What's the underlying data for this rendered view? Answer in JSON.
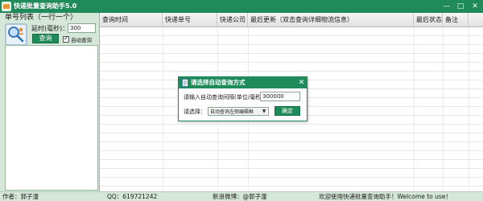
{
  "window": {
    "title": "快递批量查询助手5.0",
    "controls": {
      "minimize": "—",
      "maximize": "□",
      "close": "✕"
    }
  },
  "left_panel": {
    "list_title": "单号列表（一行一个）",
    "delay_label": "延时(毫秒)：",
    "delay_value": "300",
    "query_button": "查询",
    "auto_query_label": "自动查询",
    "auto_query_checked": true,
    "icons": {
      "query": "magnifier-person-icon"
    }
  },
  "table": {
    "headers": [
      "查询时间",
      "快递单号",
      "快递公司",
      "最后更新（双击查询详细物流信息）",
      "最后状态",
      "备注"
    ],
    "rows": []
  },
  "status_bar": {
    "author": "作者：郭子潼",
    "qq": "QQ：619721242",
    "weibo": "新浪微博：@郭子潼",
    "welcome": "欢迎使用快递批量查询助手！Welcome to use！"
  },
  "dialog": {
    "title": "请选择自动查询方式",
    "interval_label": "请输入自动查询间隔(单位/毫秒)：",
    "interval_value": "300000",
    "select_label": "请选择：",
    "select_value": "自动查询左侧编辑框",
    "confirm_button": "确定",
    "close": "✕"
  },
  "colors": {
    "title_bar": "#1f8a5a",
    "window_bg": "#d5e7d8",
    "button_bg": "#1f8a5a"
  }
}
